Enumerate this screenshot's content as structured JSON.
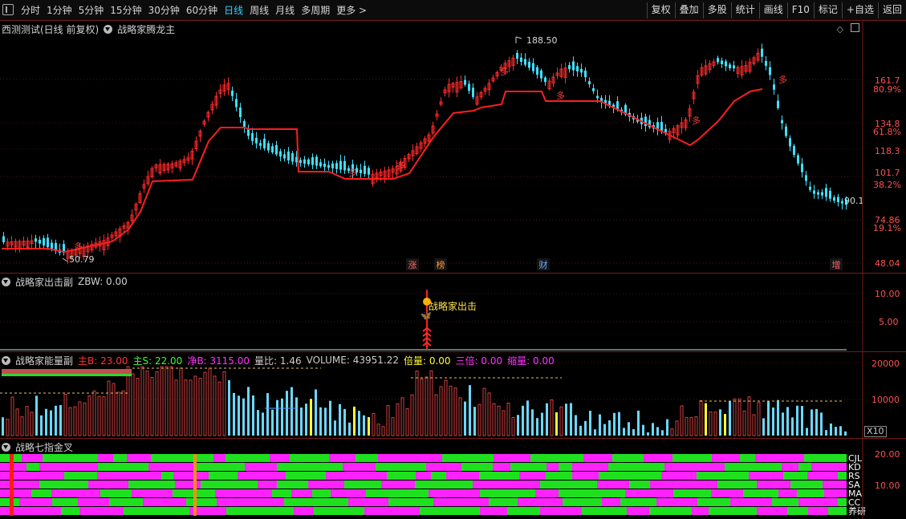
{
  "toolbar": {
    "timeframes": [
      "分时",
      "1分钟",
      "5分钟",
      "15分钟",
      "30分钟",
      "60分钟",
      "日线",
      "周线",
      "月线",
      "多周期",
      "更多 >"
    ],
    "active_timeframe": "日线",
    "right_tools": [
      "复权",
      "叠加",
      "多股",
      "统计",
      "画线",
      "F10",
      "标记",
      "+自选",
      "返回"
    ]
  },
  "main_chart": {
    "stock_label": "西测测试(日线 前复权)",
    "indicator_name": "战略家腾龙主",
    "price_ticks": [
      "161.7",
      "134.8",
      "118.3",
      "101.7",
      "74.86",
      "48.04"
    ],
    "percent_ticks": [
      "80.9%",
      "61.8%",
      "38.2%",
      "19.1%"
    ],
    "high_label": "188.50",
    "low_label": "50.79",
    "last_label": "90.1",
    "event_markers": [
      "涨",
      "榜",
      "财",
      "增"
    ],
    "colors": {
      "up": "#ff2a2a",
      "down": "#3fe0ff",
      "support_line": "#ff2020"
    }
  },
  "pane2": {
    "indicator_name": "战略家出击副",
    "values_text": "ZBW: 0.00",
    "signal_label": "战略家出击",
    "ticks": [
      "10.00",
      "5.00"
    ]
  },
  "pane3": {
    "indicator_name": "战略家能量副",
    "legend": [
      {
        "text": "主B: 23.00",
        "color": "#ff3333"
      },
      {
        "text": "主S: 22.00",
        "color": "#33ff33"
      },
      {
        "text": "净B: 3115.00",
        "color": "#ff33ff"
      },
      {
        "text": "量比: 1.46",
        "color": "#cccccc"
      },
      {
        "text": "VOLUME: 43951.22",
        "color": "#cccccc"
      },
      {
        "text": "倍量: 0.00",
        "color": "#ffff33"
      },
      {
        "text": "三倍: 0.00",
        "color": "#ff33ff"
      },
      {
        "text": "缩量: 0.00",
        "color": "#ff33ff"
      }
    ],
    "ticks": [
      "20000",
      "10000"
    ],
    "unit": "X10"
  },
  "pane4": {
    "indicator_name": "战略七指金叉",
    "row_labels": [
      "CJL",
      "KD",
      "RS",
      "SA",
      "MA",
      "CC",
      "养研"
    ],
    "ticks": [
      "20.00",
      "10.00"
    ],
    "colors": {
      "bull": "#1fe01f",
      "bear": "#ff22ff"
    }
  }
}
